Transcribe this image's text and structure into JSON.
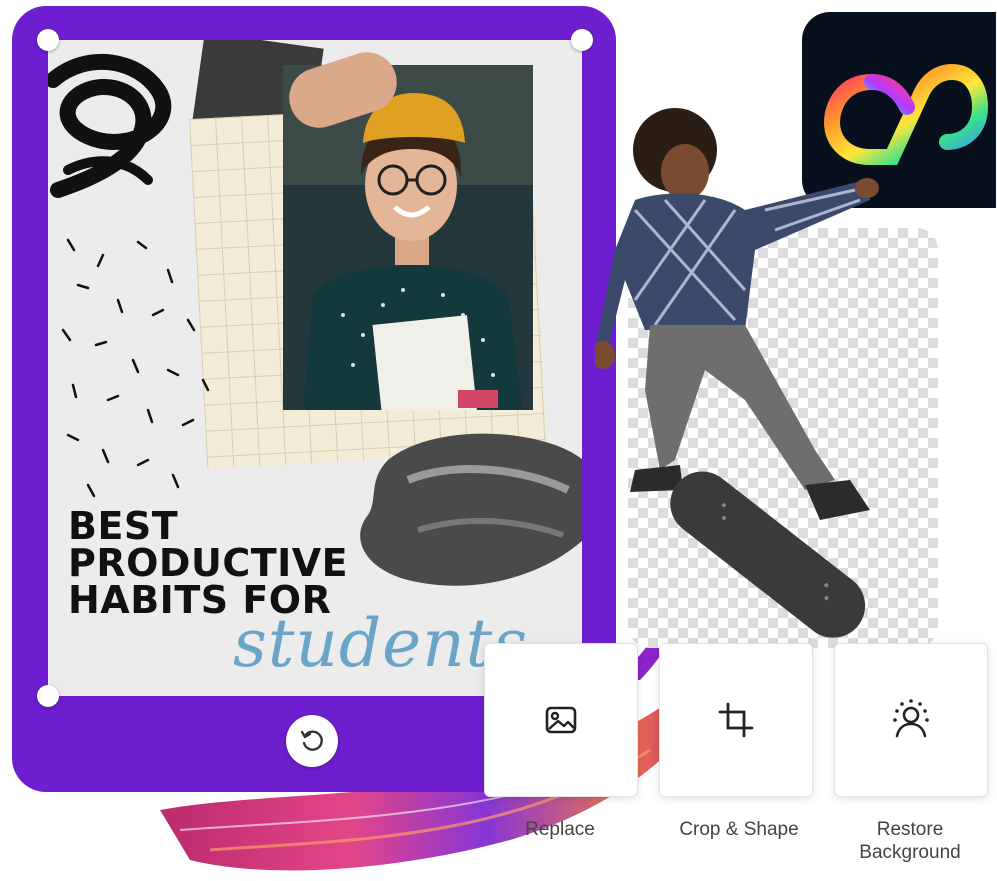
{
  "headline": {
    "line1": "BEST",
    "line2": "PRODUCTIVE",
    "line3": "HABITS FOR",
    "script": "students"
  },
  "tools": [
    {
      "label": "Replace",
      "icon": "image-icon"
    },
    {
      "label": "Crop & Shape",
      "icon": "crop-icon"
    },
    {
      "label": "Restore\nBackground",
      "icon": "restore-background-icon"
    }
  ],
  "frame": {
    "rotate_icon": "rotate-icon"
  },
  "app_icon": "creative-cloud-icon",
  "colors": {
    "frame": "#6d1fcf",
    "script_text": "#6aa5c9",
    "app_icon_bg": "#08101d"
  }
}
